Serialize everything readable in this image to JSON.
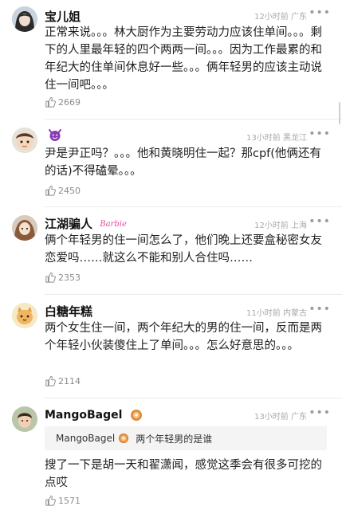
{
  "comments": [
    {
      "author": "宝儿姐",
      "time": "12小时前",
      "location": "广东",
      "text": "正常来说。。。林大厨作为主要劳动力应该住单间。。。剩下的人里最年轻的四个两两一间。。。因为工作最累的和年纪大的住单间休息好一些。。。俩年轻男的应该主动说住一间吧。。。",
      "likes": "2669",
      "avatar_icon": "girl-portrait-avatar"
    },
    {
      "author": "",
      "author_icon": "devil-emoji-icon",
      "time": "13小时前",
      "location": "黑龙江",
      "text": "尹是尹正吗？。。。他和黄晓明住一起？那cpf(他俩还有的话)不得磕晕。。。",
      "likes": "2450",
      "avatar_icon": "cartoon-face-avatar"
    },
    {
      "author": "江湖骗人",
      "author_badge": "Barbie",
      "time": "12小时前",
      "location": "上海",
      "text": "俩个年轻男的住一间怎么了，他们晚上还要盒秘密女友恋爱吗……就这么不能和别人合住吗……",
      "likes": "2353",
      "avatar_icon": "doll-avatar"
    },
    {
      "author": "白糖年糕",
      "time": "11小时前",
      "location": "内蒙古",
      "text": "两个女生住一间，两个年纪大的男的住一间，反而是两个年轻小伙装傻住上了单间。。。怎么好意思的。。。",
      "likes": "2114",
      "avatar_icon": "cat-avatar"
    },
    {
      "author": "MangoBagel",
      "author_icon": "bagel-emoji-icon",
      "time": "13小时前",
      "location": "广东",
      "reply_author": "MangoBagel",
      "reply_text": "两个年轻男的是谁",
      "text": "搜了一下是胡一天和翟潇闻，感觉这季会有很多可挖的点哎",
      "likes": "1571",
      "avatar_icon": "child-portrait-avatar"
    }
  ],
  "more_label": "•••",
  "colors": {
    "meta": "#a8a8a8",
    "text": "#1f1f1f",
    "divider": "#ececec"
  }
}
